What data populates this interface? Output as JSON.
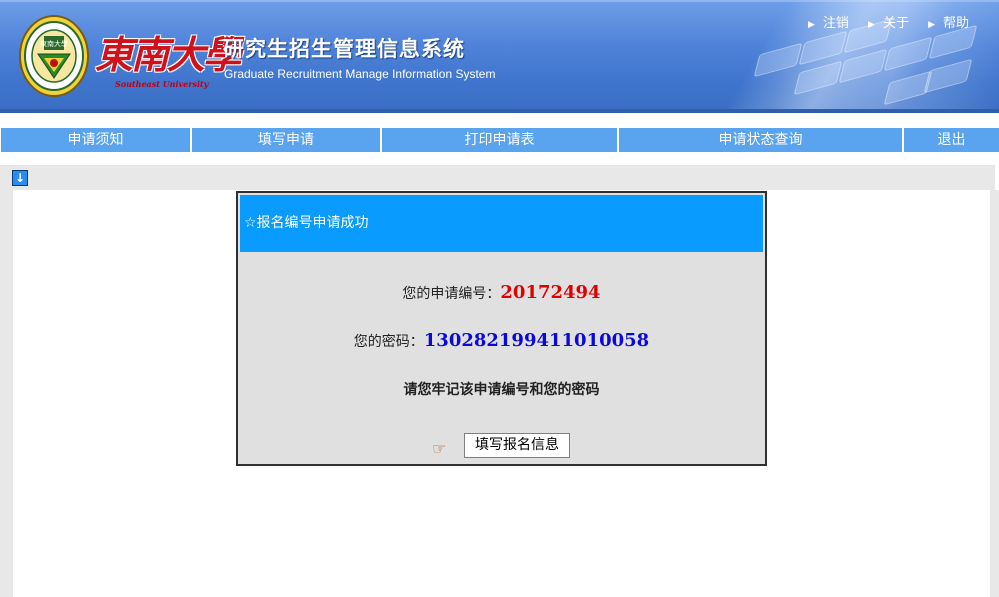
{
  "header": {
    "school_name": "東南大學",
    "school_name_en": "Southeast University",
    "system_title_cn": "研究生招生管理信息系统",
    "system_title_en": "Graduate Recruitment Manage Information System",
    "top_links": [
      "注销",
      "关于",
      "帮助"
    ]
  },
  "nav": {
    "items": [
      "申请须知",
      "填写申请",
      "打印申请表",
      "申请状态查询",
      "退出"
    ]
  },
  "dialog": {
    "title": "☆报名编号申请成功",
    "id_label": "您的申请编号：",
    "id_value": "20172494",
    "password_label": "您的密码：",
    "password_value": "130282199411010058",
    "reminder": "请您牢记该申请编号和您的密码",
    "button_label": "填写报名信息",
    "hand_icon": "pointing-hand-icon"
  },
  "colors": {
    "banner_blue": "#4f83d9",
    "nav_blue": "#5aa3ee",
    "dialog_title_blue": "#0a9bff",
    "id_red": "#e00000",
    "password_blue": "#0a0ad8",
    "dialog_bg": "#e0e0e0"
  }
}
